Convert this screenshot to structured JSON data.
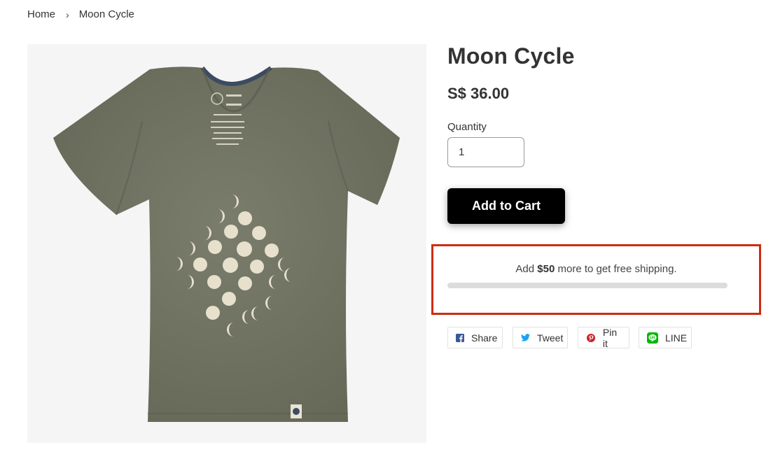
{
  "breadcrumb": {
    "home": "Home",
    "separator": "›",
    "current": "Moon Cycle"
  },
  "product": {
    "title": "Moon Cycle",
    "price": "S$ 36.00",
    "image_alt": "Moon Cycle",
    "shirt_tag_lines": [
      "UNITED",
      "BY",
      "BLUE"
    ]
  },
  "quantity": {
    "label": "Quantity",
    "value": "1"
  },
  "cart": {
    "add_label": "Add to Cart"
  },
  "shipping": {
    "prefix": "Add ",
    "amount": "$50",
    "suffix": " more to get free shipping.",
    "progress_fraction": 0.0,
    "highlight_color": "#cc2c12"
  },
  "share": [
    {
      "label": "Share",
      "icon": "facebook-icon",
      "color": "#3b5998"
    },
    {
      "label": "Tweet",
      "icon": "twitter-icon",
      "color": "#1da1f2"
    },
    {
      "label": "Pin it",
      "icon": "pinterest-icon",
      "color": "#cb2027"
    },
    {
      "label": "LINE",
      "icon": "line-icon",
      "color": "#00b900"
    }
  ]
}
